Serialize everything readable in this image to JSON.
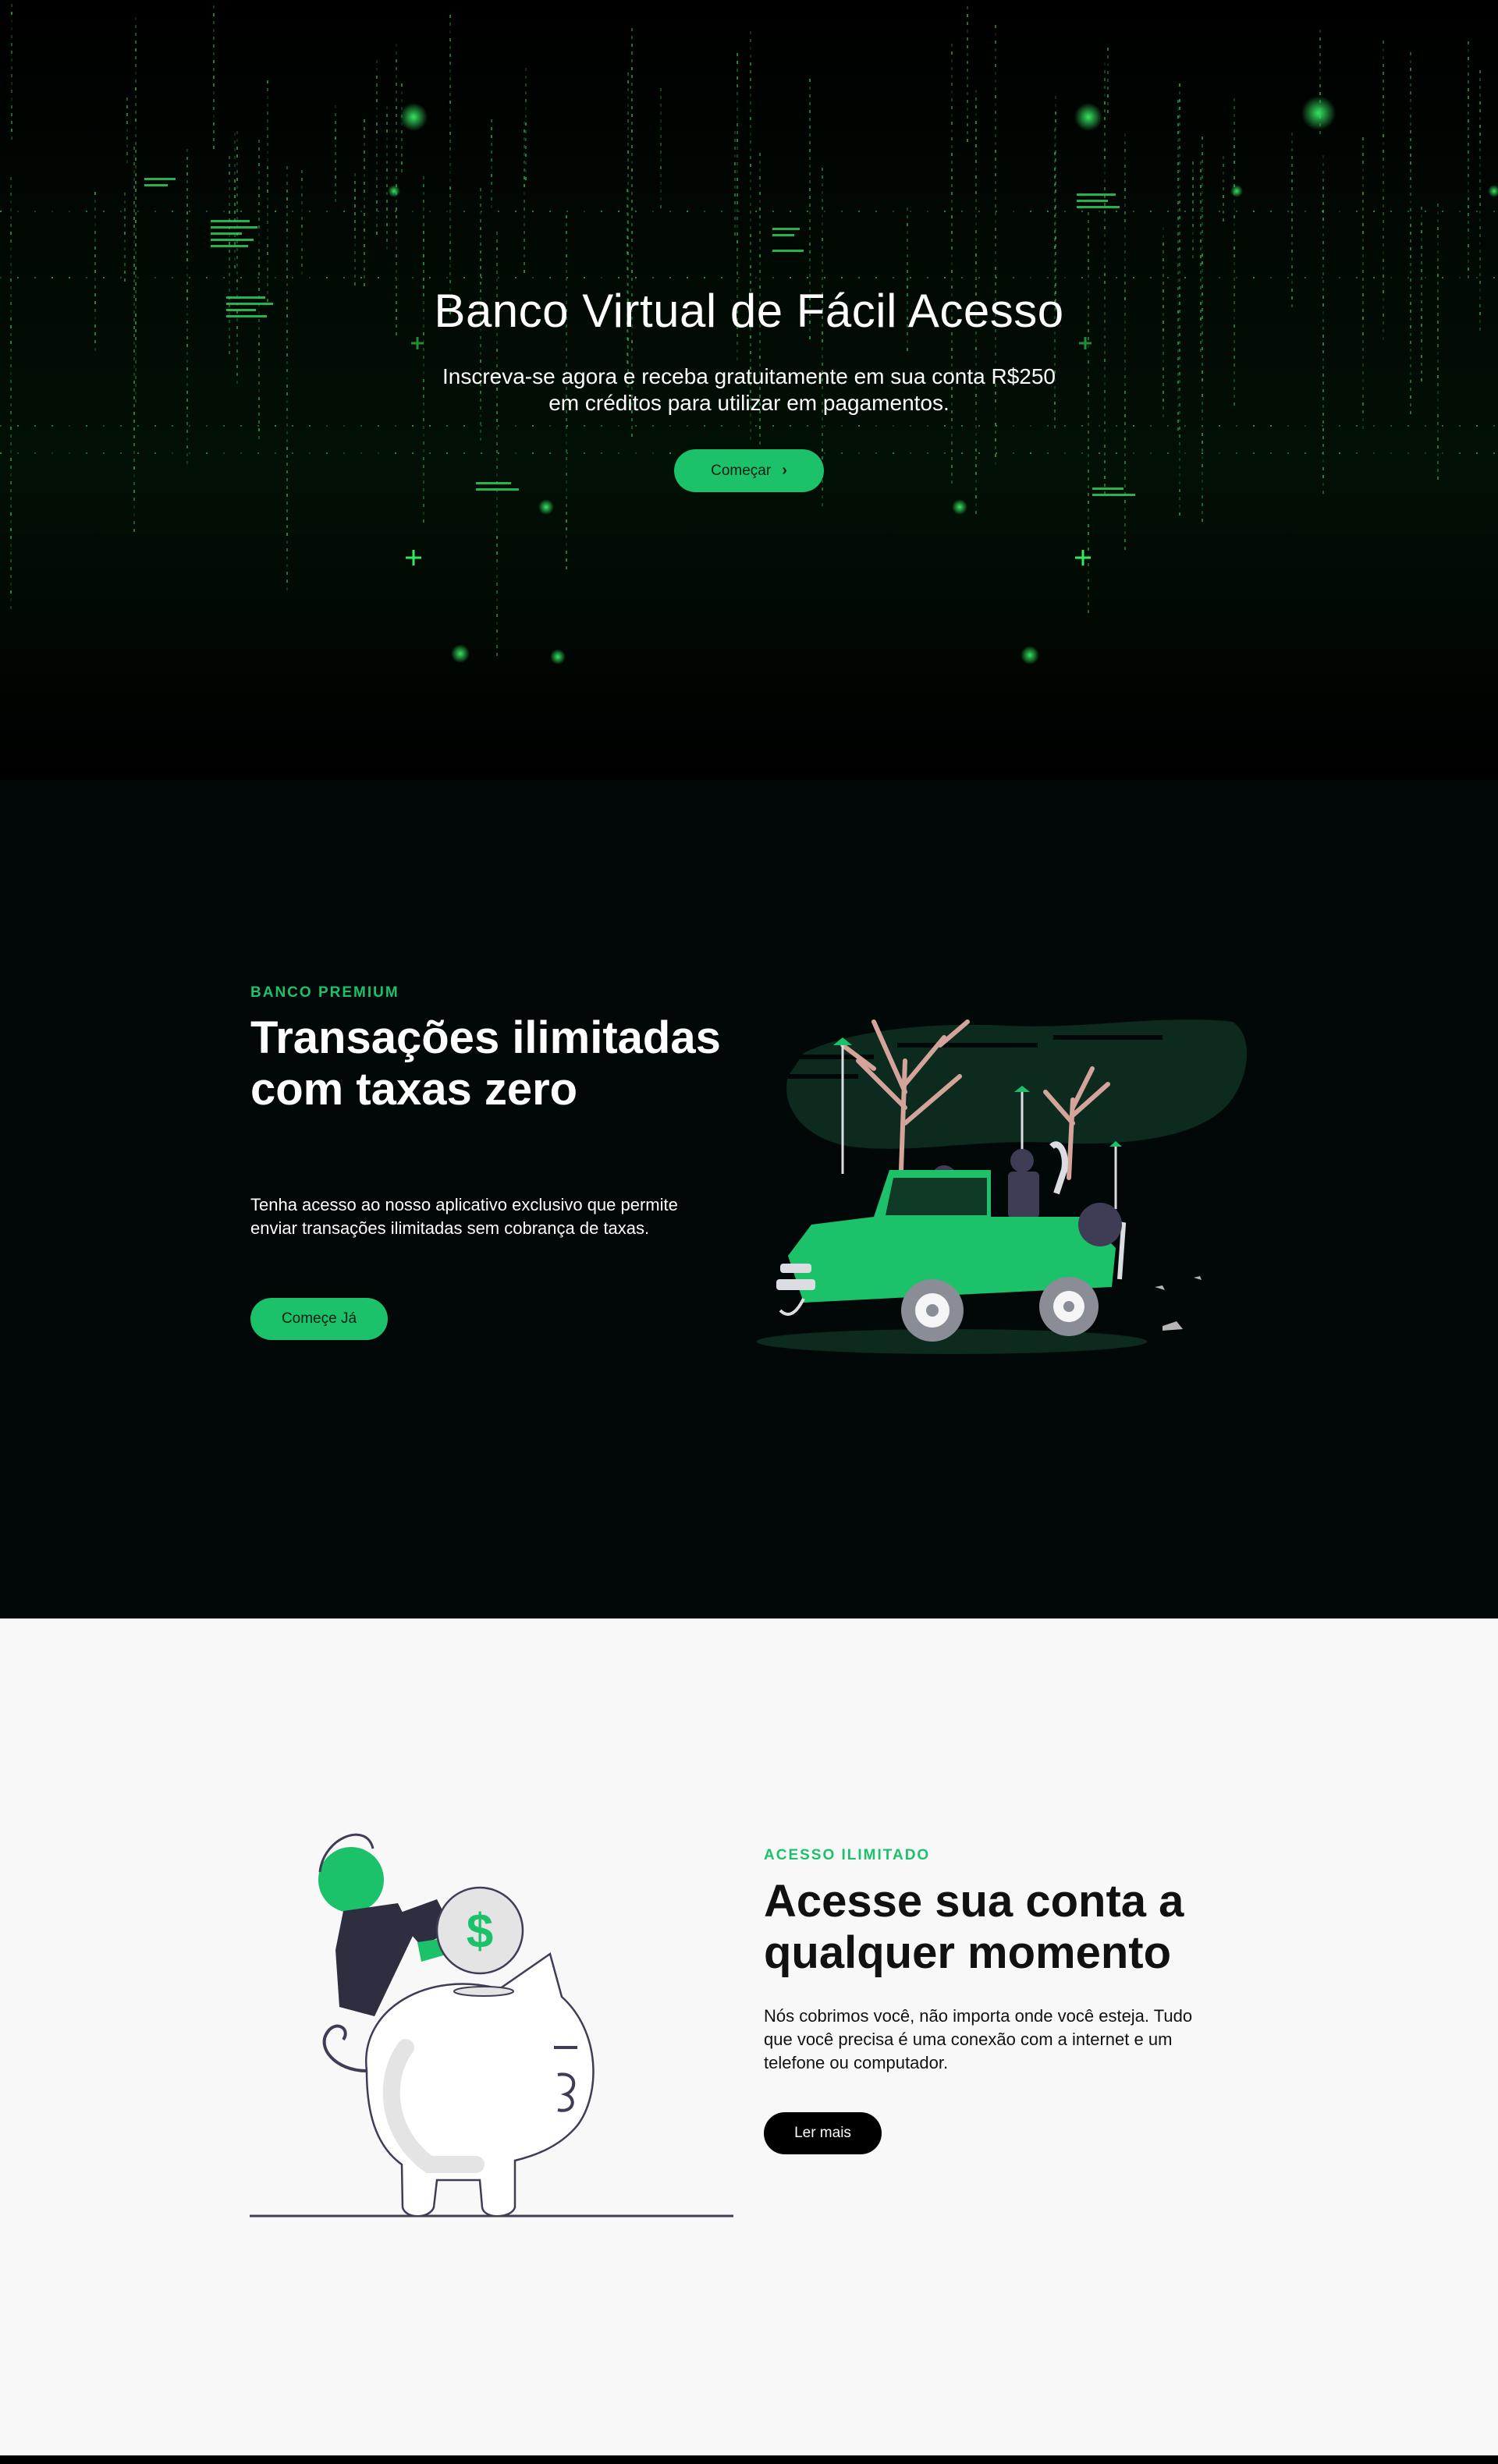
{
  "colors": {
    "accent": "#1bc26a",
    "hero_bg": "#000000",
    "premium_bg": "#020807",
    "access_bg": "#f8f8f8"
  },
  "hero": {
    "title": "Banco Virtual de Fácil Acesso",
    "subtitle": "Inscreva-se agora e receba gratuitamente em sua conta R$250 em créditos para utilizar em pagamentos.",
    "button_label": "Começar",
    "button_icon": "chevron-right-icon"
  },
  "premium": {
    "eyebrow": "BANCO PREMIUM",
    "title": "Transações ilimitadas com taxas zero",
    "text": "Tenha acesso ao nosso aplicativo exclusivo que permite enviar transações ilimitadas sem cobrança de taxas.",
    "button_label": "Começe Já"
  },
  "access": {
    "eyebrow": "ACESSO ILIMITADO",
    "title": "Acesse sua conta a qualquer momento",
    "text": "Nós cobrimos você, não importa onde você esteja. Tudo que você precisa é uma conexão com a internet e um telefone ou computador.",
    "button_label": "Ler mais"
  }
}
